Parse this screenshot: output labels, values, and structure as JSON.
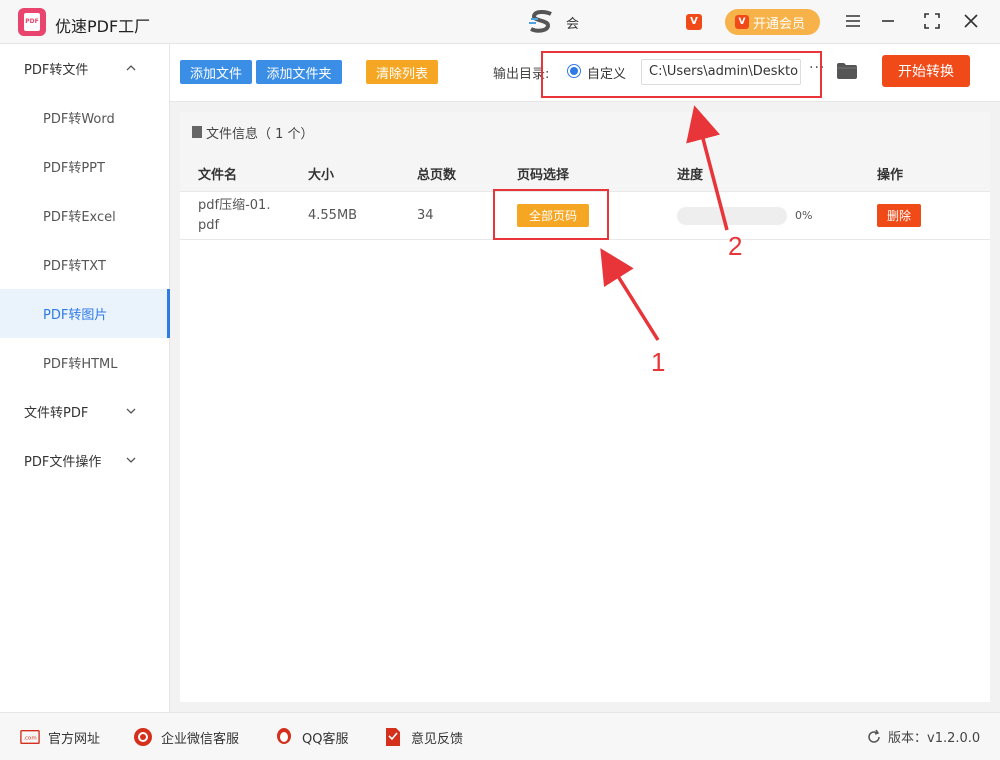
{
  "app": {
    "title": "优速PDF工厂",
    "logo_text": "PDF",
    "center_text": "会",
    "vip_label": "开通会员"
  },
  "sidebar": {
    "groups": [
      {
        "label": "PDF转文件",
        "expanded": true
      },
      {
        "label": "文件转PDF",
        "expanded": false
      },
      {
        "label": "PDF文件操作",
        "expanded": false
      }
    ],
    "items": [
      {
        "label": "PDF转Word"
      },
      {
        "label": "PDF转PPT"
      },
      {
        "label": "PDF转Excel"
      },
      {
        "label": "PDF转TXT"
      },
      {
        "label": "PDF转图片",
        "active": true
      },
      {
        "label": "PDF转HTML"
      }
    ]
  },
  "toolbar": {
    "add_file": "添加文件",
    "add_folder": "添加文件夹",
    "clear_list": "清除列表",
    "output_label": "输出目录:",
    "radio_label": "自定义",
    "output_path": "C:\\Users\\admin\\Deskto",
    "more": "···",
    "convert": "开始转换"
  },
  "panel": {
    "header": "文件信息（ 1 个）",
    "columns": [
      "文件名",
      "大小",
      "总页数",
      "页码选择",
      "进度",
      "操作"
    ],
    "rows": [
      {
        "filename_line1": "pdf压缩-01.",
        "filename_line2": "pdf",
        "size": "4.55MB",
        "pages": "34",
        "page_select": "全部页码",
        "progress_text": "0%",
        "progress_value": 0,
        "action": "删除"
      }
    ]
  },
  "footer": {
    "website": "官方网址",
    "wechat": "企业微信客服",
    "qq": "QQ客服",
    "feedback": "意见反馈",
    "version": "版本：v1.2.0.0"
  },
  "annotations": {
    "label_1": "1",
    "label_2": "2"
  },
  "colors": {
    "accent_blue": "#3a8ee6",
    "accent_orange": "#f5a623",
    "accent_red": "#f04a18",
    "annotation_red": "#e8353a"
  }
}
